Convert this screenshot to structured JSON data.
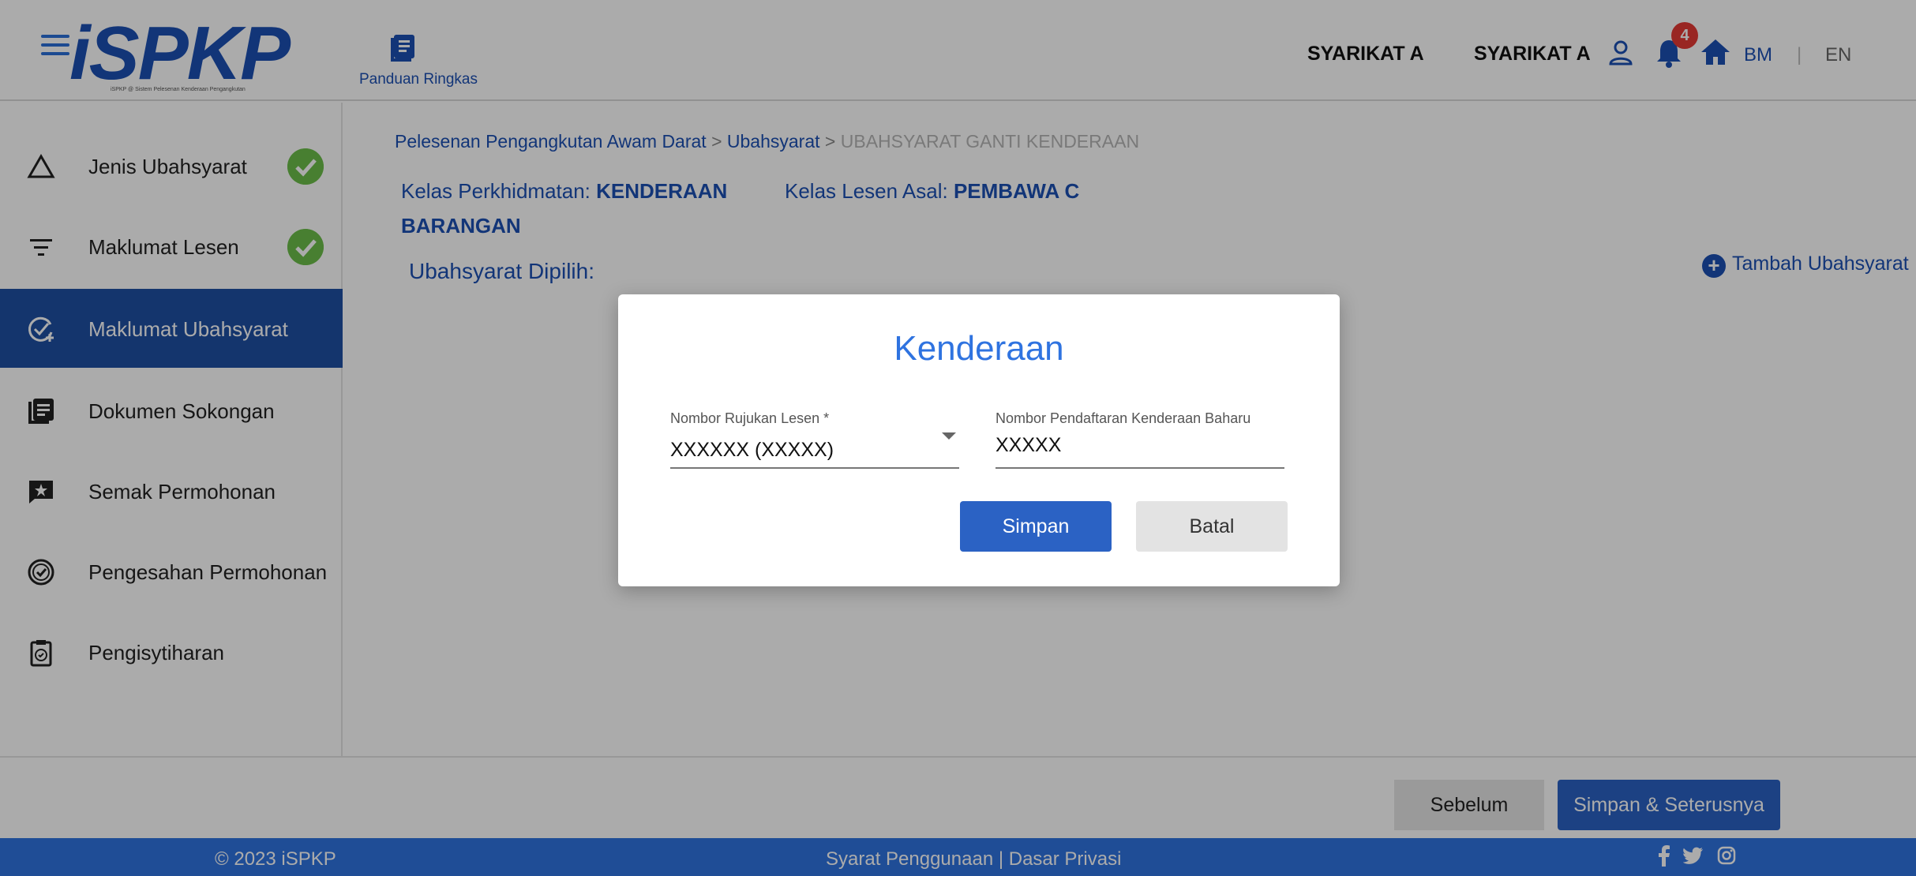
{
  "header": {
    "logo_text": "iSPKP",
    "logo_tagline": "iSPKP @ Sistem Pelesenan Kenderaan Pengangkutan",
    "quick_guide_label": "Panduan Ringkas",
    "company_name": "SYARIKAT A",
    "user_company": "SYARIKAT A",
    "notification_count": "4",
    "lang_bm": "BM",
    "lang_sep": "|",
    "lang_en": "EN"
  },
  "sidebar": {
    "items": [
      {
        "label": "Jenis Ubahsyarat",
        "icon": "triangle-icon",
        "completed": true
      },
      {
        "label": "Maklumat Lesen",
        "icon": "filter-icon",
        "completed": true
      },
      {
        "label": "Maklumat Ubahsyarat",
        "icon": "check-add-icon",
        "active": true
      },
      {
        "label": "Dokumen Sokongan",
        "icon": "documents-icon"
      },
      {
        "label": "Semak Permohonan",
        "icon": "review-icon"
      },
      {
        "label": "Pengesahan Permohonan",
        "icon": "verify-icon"
      },
      {
        "label": "Pengisytiharan",
        "icon": "clipboard-icon"
      }
    ]
  },
  "main": {
    "breadcrumb": {
      "level1": "Pelesenan Pengangkutan Awam Darat",
      "sep": ">",
      "level2": "Ubahsyarat",
      "current": "UBAHSYARAT GANTI KENDERAAN"
    },
    "service_class_label": "Kelas Perkhidmatan:",
    "service_class_value": "KENDERAAN BARANGAN",
    "original_license_label": "Kelas Lesen Asal:",
    "original_license_value": "PEMBAWA C",
    "chosen_label": "Ubahsyarat Dipilih:",
    "add_button": "Tambah Ubahsyarat"
  },
  "bottom_bar": {
    "prev_button": "Sebelum",
    "next_button": "Simpan & Seterusnya"
  },
  "footer": {
    "copyright": "© 2023 iSPKP",
    "terms": "Syarat Penggunaan | Dasar Privasi",
    "social": [
      "facebook-icon",
      "twitter-icon",
      "instagram-icon"
    ]
  },
  "modal": {
    "title": "Kenderaan",
    "license_ref_label": "Nombor Rujukan Lesen *",
    "license_ref_value": "XXXXXX (XXXXX)",
    "new_reg_label": "Nombor Pendaftaran Kenderaan Baharu",
    "new_reg_value": "XXXXX",
    "save_button": "Simpan",
    "cancel_button": "Batal"
  },
  "colors": {
    "primary": "#1c4fb3",
    "active_nav": "#1f4fa3",
    "button_blue": "#2b62c4",
    "footer": "#2f73e0",
    "success": "#6cbe4a",
    "badge": "#e53935"
  }
}
